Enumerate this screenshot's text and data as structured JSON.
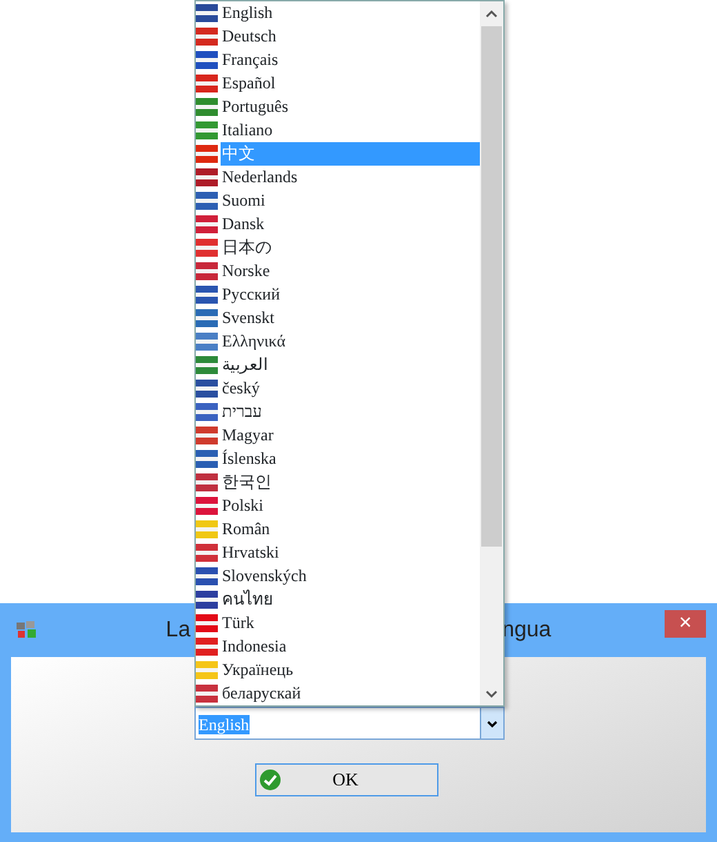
{
  "window": {
    "title_parts": [
      "La",
      "ngua"
    ],
    "close": "×"
  },
  "language_list": {
    "items": [
      {
        "label": "English",
        "selected": false,
        "color": "#2a4b9b"
      },
      {
        "label": "Deutsch",
        "selected": false,
        "color": "#d42a1f"
      },
      {
        "label": "Français",
        "selected": false,
        "color": "#1f4fbf"
      },
      {
        "label": "Español",
        "selected": false,
        "color": "#d8261d"
      },
      {
        "label": "Português",
        "selected": false,
        "color": "#2f8d2f"
      },
      {
        "label": "Italiano",
        "selected": false,
        "color": "#339933"
      },
      {
        "label": "中文",
        "selected": true,
        "color": "#de2910"
      },
      {
        "label": "Nederlands",
        "selected": false,
        "color": "#ae1c28"
      },
      {
        "label": "Suomi",
        "selected": false,
        "color": "#2d5fb3"
      },
      {
        "label": "Dansk",
        "selected": false,
        "color": "#d0203a"
      },
      {
        "label": "日本の",
        "selected": false,
        "color": "#e03030"
      },
      {
        "label": "Norske",
        "selected": false,
        "color": "#c8283a"
      },
      {
        "label": "Русский",
        "selected": false,
        "color": "#2a55b0"
      },
      {
        "label": "Svenskt",
        "selected": false,
        "color": "#2a6bb5"
      },
      {
        "label": "Ελληνικά",
        "selected": false,
        "color": "#4a7fc5"
      },
      {
        "label": "العربية",
        "selected": false,
        "color": "#2d8a3a"
      },
      {
        "label": "český",
        "selected": false,
        "color": "#2a4fa0"
      },
      {
        "label": "עברית",
        "selected": false,
        "color": "#3a62c0"
      },
      {
        "label": "Magyar",
        "selected": false,
        "color": "#cf3b2d"
      },
      {
        "label": "Íslenska",
        "selected": false,
        "color": "#2a5fb3"
      },
      {
        "label": "한국인",
        "selected": false,
        "color": "#c03040"
      },
      {
        "label": "Polski",
        "selected": false,
        "color": "#dc143c"
      },
      {
        "label": "Român",
        "selected": false,
        "color": "#f0c814"
      },
      {
        "label": "Hrvatski",
        "selected": false,
        "color": "#d0303a"
      },
      {
        "label": "Slovenských",
        "selected": false,
        "color": "#2a50b0"
      },
      {
        "label": "คนไทย",
        "selected": false,
        "color": "#2d3fa0"
      },
      {
        "label": "Türk",
        "selected": false,
        "color": "#e30a17"
      },
      {
        "label": "Indonesia",
        "selected": false,
        "color": "#e02020"
      },
      {
        "label": "Українець",
        "selected": false,
        "color": "#f5c518"
      },
      {
        "label": "беларускай",
        "selected": false,
        "color": "#c8313e"
      }
    ]
  },
  "combo": {
    "value": "English"
  },
  "ok_button": {
    "label": "OK"
  }
}
